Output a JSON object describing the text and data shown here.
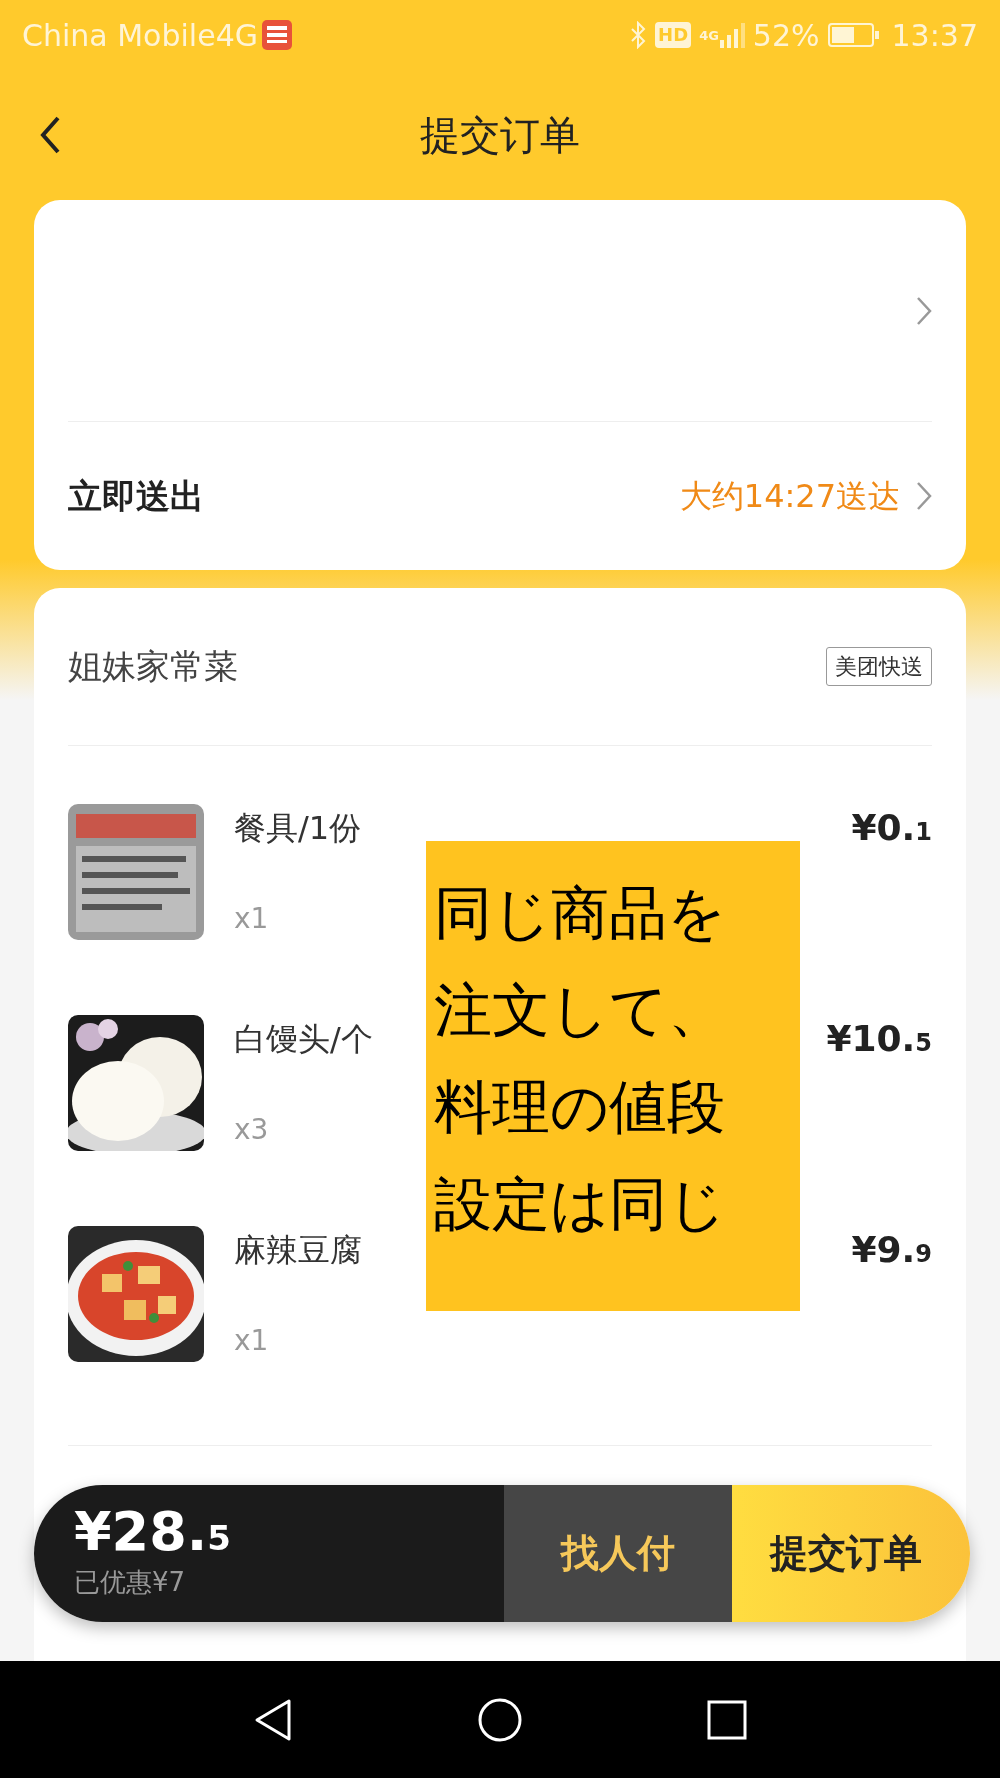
{
  "status_bar": {
    "carrier": "China Mobile4G",
    "hd": "HD",
    "network": "4G",
    "battery": "52%",
    "time": "13:37"
  },
  "header": {
    "title": "提交订单"
  },
  "delivery": {
    "label": "立即送出",
    "eta": "大约14:27送达"
  },
  "store": {
    "name": "姐妹家常菜",
    "badge": "美团快送"
  },
  "items": [
    {
      "name": "餐具/1份",
      "qty": "x1",
      "price": "¥0.1"
    },
    {
      "name": "白馒头/个",
      "qty": "x3",
      "price": "¥10.5"
    },
    {
      "name": "麻辣豆腐",
      "qty": "x1",
      "price": "¥9.9"
    }
  ],
  "note": {
    "text": "同じ商品を注文して、料理の値段設定は同じ"
  },
  "checkout": {
    "total": "¥28.5",
    "discount": "已优惠¥7",
    "pay_for_me": "找人付",
    "submit": "提交订单"
  }
}
